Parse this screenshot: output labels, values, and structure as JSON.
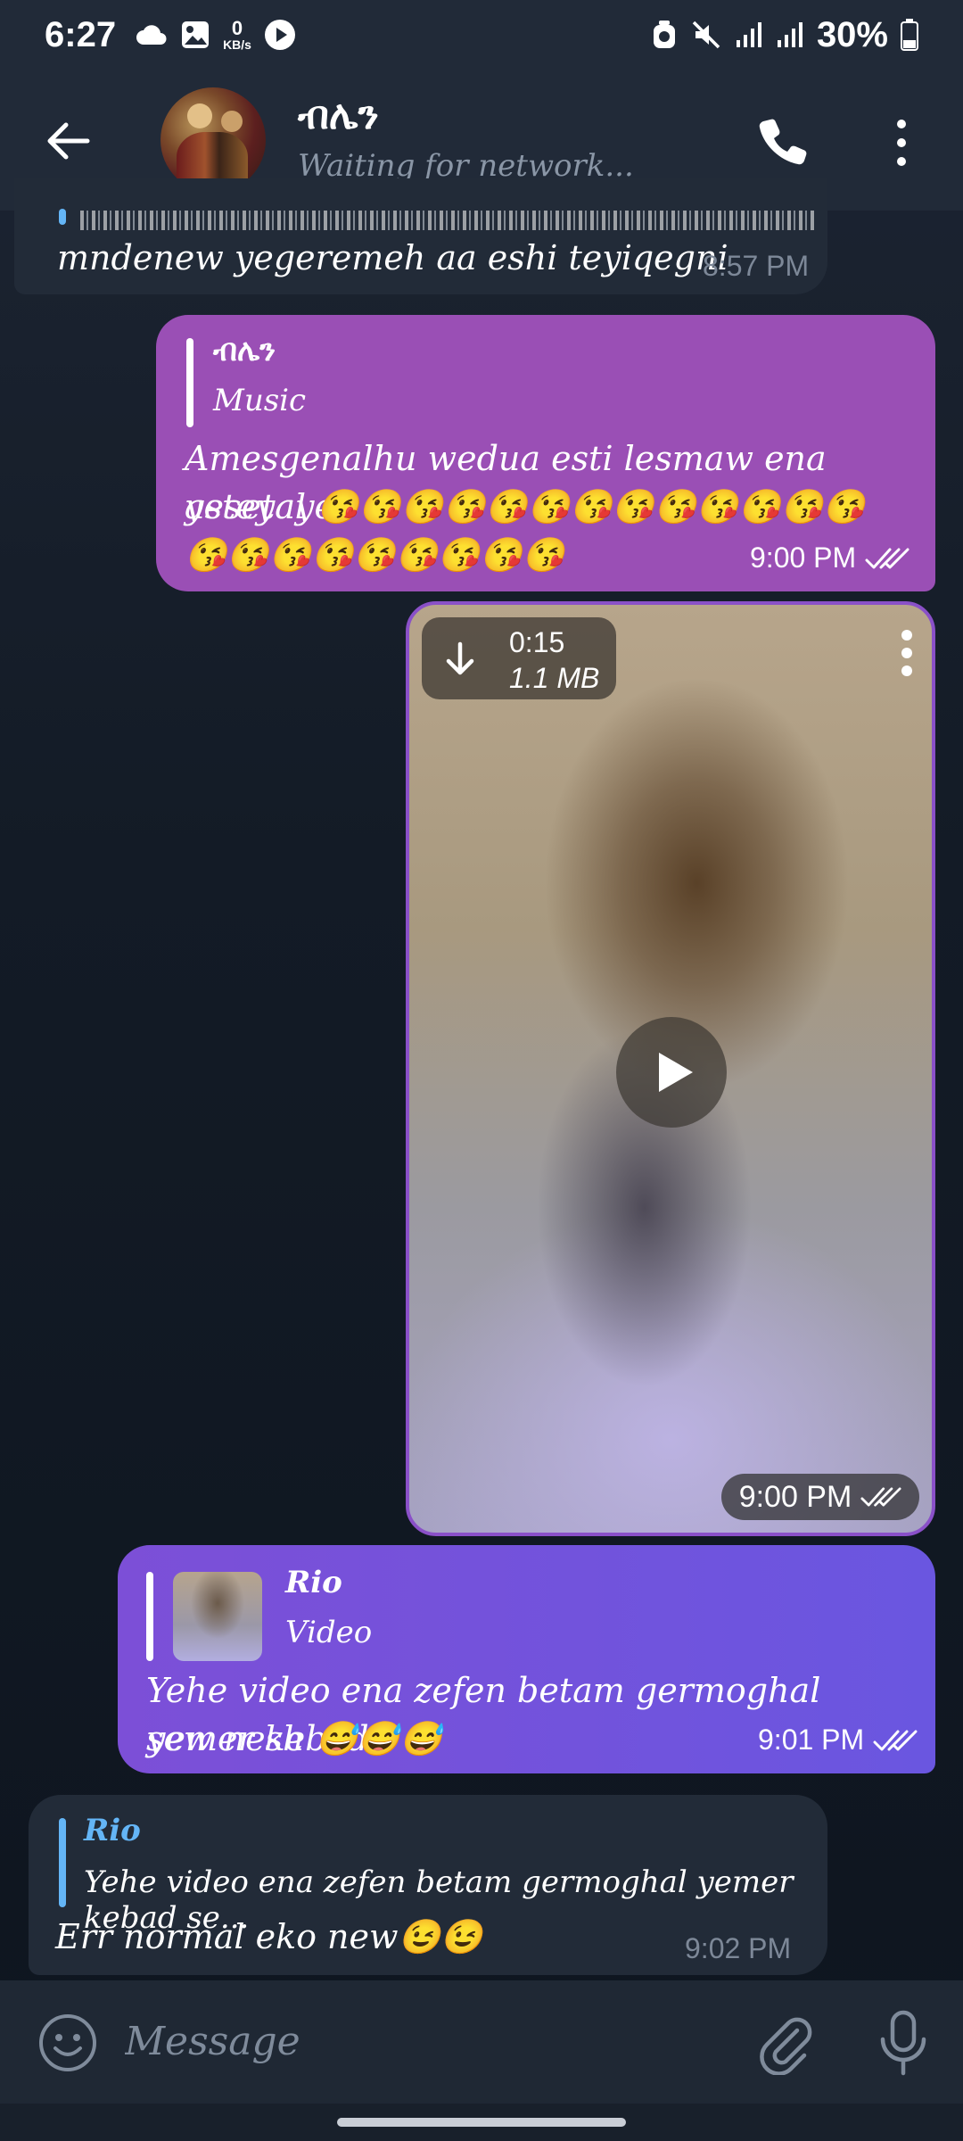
{
  "status_bar": {
    "time": "6:27",
    "net_speed_value": "0",
    "net_speed_unit": "KB/s",
    "battery": "30%"
  },
  "header": {
    "name": "ብሌን",
    "status": "Waiting for network..."
  },
  "messages": [
    {
      "type": "incoming",
      "text": "mndenew yegeremeh aa eshi teyiqegni",
      "time": "8:57 PM"
    },
    {
      "type": "outgoing",
      "reply_name": "ብሌን",
      "reply_text": "Music",
      "text_line1": "Amesgenalhu wedua esti lesmaw ena asteyayet",
      "text_line2": "yesetal 😘😘😘😘😘😘😘😘😘😘😘😘😘",
      "text_line3": "😘😘😘😘😘😘😘😘😘",
      "time": "9:00 PM"
    },
    {
      "type": "video",
      "duration": "0:15",
      "size": "1.1 MB",
      "time": "9:00 PM"
    },
    {
      "type": "outgoing",
      "reply_name": "Rio",
      "reply_text": "Video",
      "text_line1": "Yehe video ena zefen betam germoghal yemer kebad",
      "text_line2": "sew nesh 😅😅😅",
      "time": "9:01 PM"
    },
    {
      "type": "incoming",
      "reply_name": "Rio",
      "reply_text": "Yehe video ena zefen betam germoghal yemer kebad se...",
      "text": "Err normal eko new😉😉",
      "time": "9:02 PM"
    }
  ],
  "input": {
    "placeholder": "Message"
  },
  "colors": {
    "accent_quote": "#64b5f6",
    "outgoing_pink": "#9a4fb5",
    "outgoing_indigo": "#6a56e0",
    "incoming": "#222b38"
  }
}
